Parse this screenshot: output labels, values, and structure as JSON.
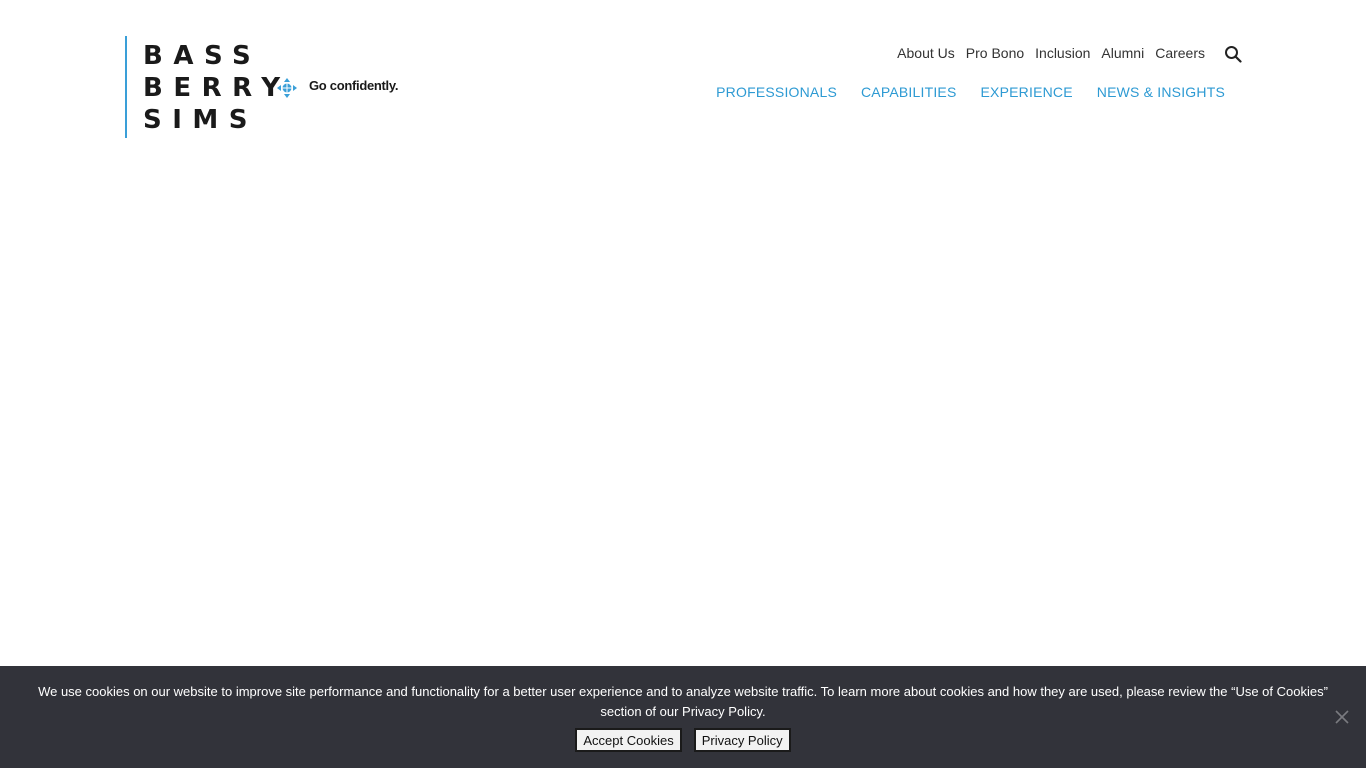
{
  "logo": {
    "line1": "BASS",
    "line2": "BERRY",
    "line3": "SIMS",
    "tagline": "Go confidently.",
    "accent_color": "#3a9fd8"
  },
  "utility_nav": {
    "items": [
      "About Us",
      "Pro Bono",
      "Inclusion",
      "Alumni",
      "Careers"
    ],
    "search_icon": "search-icon"
  },
  "main_nav": {
    "items": [
      "PROFESSIONALS",
      "CAPABILITIES",
      "EXPERIENCE",
      "NEWS & INSIGHTS"
    ],
    "color": "#2d9ad3"
  },
  "cookie_banner": {
    "message": "We use cookies on our website to improve site performance and functionality for a better user experience and to analyze website traffic. To learn more about cookies and how they are used, please review the “Use of Cookies” section of our Privacy Policy.",
    "accept_label": "Accept Cookies",
    "privacy_label": "Privacy Policy",
    "close_icon": "close-icon",
    "background": "#32333a"
  }
}
